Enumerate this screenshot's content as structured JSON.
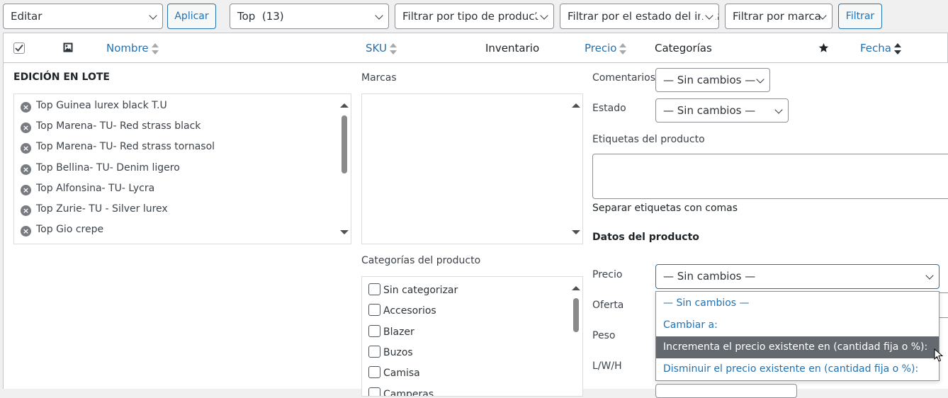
{
  "toolbar": {
    "bulk_action_value": "Editar",
    "apply_label": "Aplicar",
    "category_filter_value": "Top  (13)",
    "product_type_filter_value": "Filtrar por tipo de producto",
    "stock_status_filter_value": "Filtrar por el estado del inventario",
    "brand_filter_value": "Filtrar por marca",
    "filter_label": "Filtrar"
  },
  "table_header": {
    "name": "Nombre",
    "sku": "SKU",
    "stock": "Inventario",
    "price": "Precio",
    "categories": "Categorías",
    "date": "Fecha",
    "image_icon": "image-icon",
    "featured_icon": "star-icon"
  },
  "bulk_edit": {
    "title": "EDICIÓN EN LOTE",
    "products": [
      "Top Guinea lurex black T.U",
      "Top Marena- TU- Red strass black",
      "Top Marena- TU- Red strass tornasol",
      "Top Bellina- TU- Denim ligero",
      "Top Alfonsina- TU- Lycra",
      "Top Zurie- TU - Silver lurex",
      "Top Gio crepe"
    ],
    "brands_label": "Marcas",
    "product_categories_label": "Categorías del producto",
    "categories": [
      "Sin categorizar",
      "Accesorios",
      "Blazer",
      "Buzos",
      "Camisa",
      "Camperas"
    ],
    "comments_label": "Comentarios",
    "comments_value": "— Sin cambios —",
    "status_label": "Estado",
    "status_value": "— Sin cambios —",
    "tags_label": "Etiquetas del producto",
    "tags_hint": "Separar etiquetas con comas",
    "product_data_title": "Datos del producto",
    "price_label": "Precio",
    "price_value": "— Sin cambios —",
    "sale_label": "Oferta",
    "weight_label": "Peso",
    "dimensions_label": "L/W/H",
    "price_options": [
      "— Sin cambios —",
      "Cambiar a:",
      "Incrementa el precio existente en (cantidad fija o %):",
      "Disminuir el precio existente en (cantidad fija o %):"
    ],
    "highlighted_option_index": 2
  },
  "colors": {
    "accent": "#2271b1",
    "highlight": "#646970",
    "background": "#f0f0f1"
  }
}
